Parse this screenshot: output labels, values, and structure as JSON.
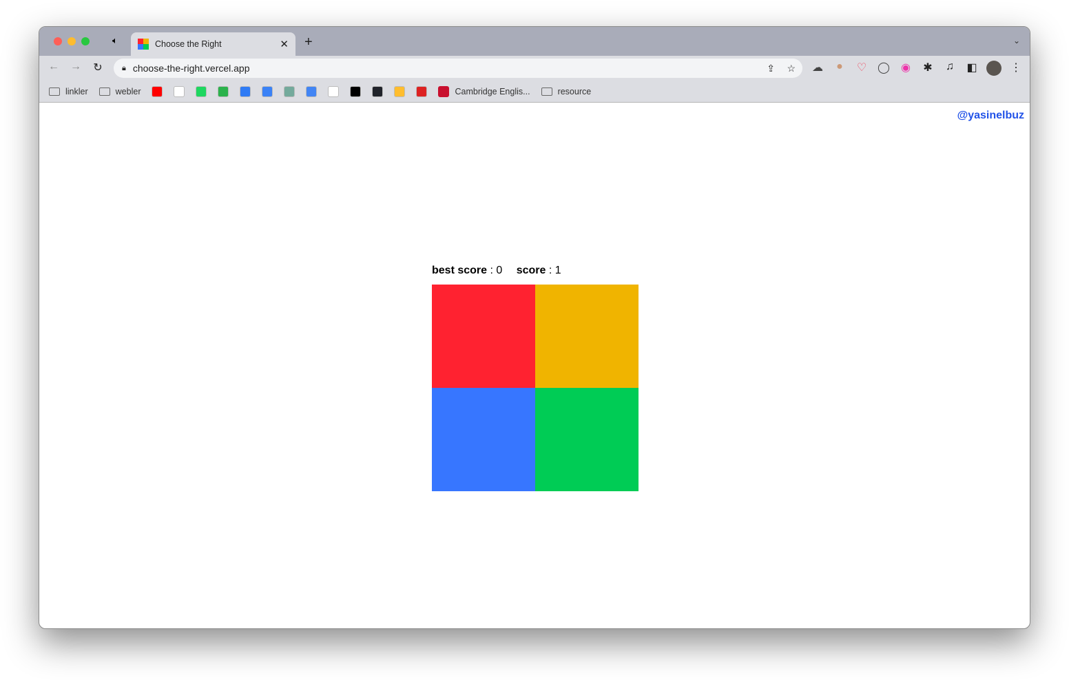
{
  "browser": {
    "tab_title": "Choose the Right",
    "url": "choose-the-right.vercel.app",
    "bookmarks": [
      {
        "label": "linkler",
        "type": "folder"
      },
      {
        "label": "webler",
        "type": "folder"
      },
      {
        "icon": "youtube-icon",
        "color": "#ff0000"
      },
      {
        "icon": "github-icon",
        "color": "#ffffff"
      },
      {
        "icon": "spotify-icon",
        "color": "#1ed760"
      },
      {
        "icon": "feedly-icon",
        "color": "#2bb24c"
      },
      {
        "icon": "cloud-app-icon",
        "color": "#2f7bf5"
      },
      {
        "icon": "bolt-icon",
        "color": "#3b82f6"
      },
      {
        "icon": "chatgpt-icon",
        "color": "#74aa9c"
      },
      {
        "icon": "google-translate-icon",
        "color": "#4285f4"
      },
      {
        "icon": "notion-icon",
        "color": "#ffffff"
      },
      {
        "icon": "dev-icon",
        "color": "#000000"
      },
      {
        "icon": "react-icon",
        "color": "#20232a"
      },
      {
        "icon": "dot-icon",
        "color": "#ffbd2e"
      },
      {
        "icon": "tower-icon",
        "color": "#d22"
      },
      {
        "label": "Cambridge Englis...",
        "type": "site",
        "icon": "cambridge-icon",
        "color": "#c8102e"
      },
      {
        "label": "resource",
        "type": "folder"
      }
    ]
  },
  "page": {
    "handle": "@yasinelbuz",
    "best_score_label": "best score",
    "best_score_value": " : 0",
    "score_label": "score",
    "score_value": " : 1"
  },
  "tiles": [
    {
      "name": "red",
      "color": "#ff2230"
    },
    {
      "name": "yellow",
      "color": "#f0b400"
    },
    {
      "name": "blue",
      "color": "#3776ff"
    },
    {
      "name": "green",
      "color": "#00cc55"
    }
  ]
}
